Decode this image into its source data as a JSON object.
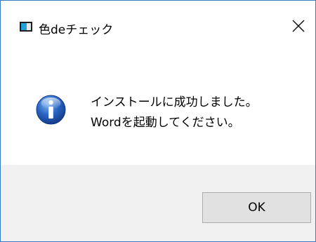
{
  "window": {
    "title": "色deチェック",
    "app_icon": "app-window-icon",
    "close_icon": "close-icon"
  },
  "dialog": {
    "icon": "information-icon",
    "message_line1": "インストールに成功しました。",
    "message_line2": "Wordを起動してください。"
  },
  "buttons": {
    "ok_label": "OK"
  },
  "colors": {
    "window_border": "#3c78c4",
    "footer_background": "#f0f0f0",
    "button_background": "#e1e1e1",
    "info_icon_blue": "#1f4fa8"
  }
}
